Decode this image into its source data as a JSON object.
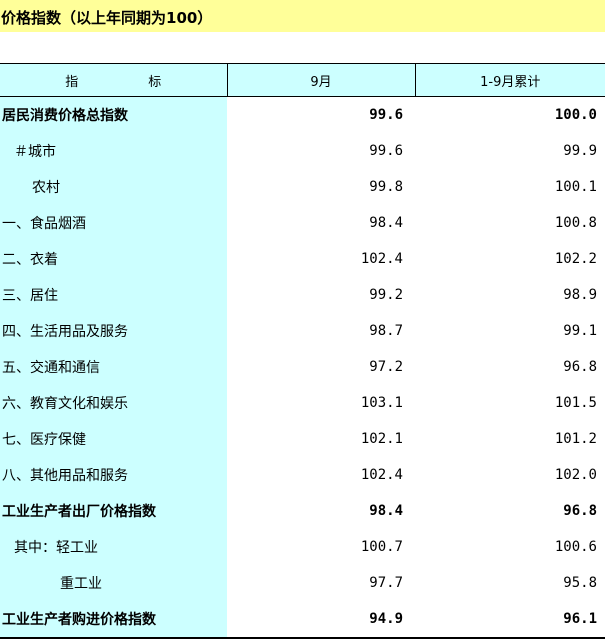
{
  "title": "价格指数（以上年同期为100）",
  "header": {
    "col1_a": "指",
    "col1_b": "标",
    "col2": "9月",
    "col3": "1-9月累计"
  },
  "rows": [
    {
      "name": "居民消费价格总指数",
      "m9": "99.6",
      "ytd": "100.0",
      "bold": true,
      "indent": 0
    },
    {
      "name": "＃城市",
      "m9": "99.6",
      "ytd": "99.9",
      "bold": false,
      "indent": 1
    },
    {
      "name": "农村",
      "m9": "99.8",
      "ytd": "100.1",
      "bold": false,
      "indent": 2
    },
    {
      "name": "一、食品烟酒",
      "m9": "98.4",
      "ytd": "100.8",
      "bold": false,
      "indent": 0
    },
    {
      "name": "二、衣着",
      "m9": "102.4",
      "ytd": "102.2",
      "bold": false,
      "indent": 0
    },
    {
      "name": "三、居住",
      "m9": "99.2",
      "ytd": "98.9",
      "bold": false,
      "indent": 0
    },
    {
      "name": "四、生活用品及服务",
      "m9": "98.7",
      "ytd": "99.1",
      "bold": false,
      "indent": 0
    },
    {
      "name": "五、交通和通信",
      "m9": "97.2",
      "ytd": "96.8",
      "bold": false,
      "indent": 0
    },
    {
      "name": "六、教育文化和娱乐",
      "m9": "103.1",
      "ytd": "101.5",
      "bold": false,
      "indent": 0
    },
    {
      "name": "七、医疗保健",
      "m9": "102.1",
      "ytd": "101.2",
      "bold": false,
      "indent": 0
    },
    {
      "name": "八、其他用品和服务",
      "m9": "102.4",
      "ytd": "102.0",
      "bold": false,
      "indent": 0
    },
    {
      "name": "工业生产者出厂价格指数",
      "m9": "98.4",
      "ytd": "96.8",
      "bold": true,
      "indent": 0
    },
    {
      "name": "其中：轻工业",
      "m9": "100.7",
      "ytd": "100.6",
      "bold": false,
      "indent": 1
    },
    {
      "name": "重工业",
      "m9": "97.7",
      "ytd": "95.8",
      "bold": false,
      "indent": 3
    },
    {
      "name": "工业生产者购进价格指数",
      "m9": "94.9",
      "ytd": "96.1",
      "bold": true,
      "indent": 0
    }
  ],
  "colors": {
    "title_bg": "#ffff99",
    "label_bg": "#ccffff",
    "marker": "#2e7d32"
  }
}
